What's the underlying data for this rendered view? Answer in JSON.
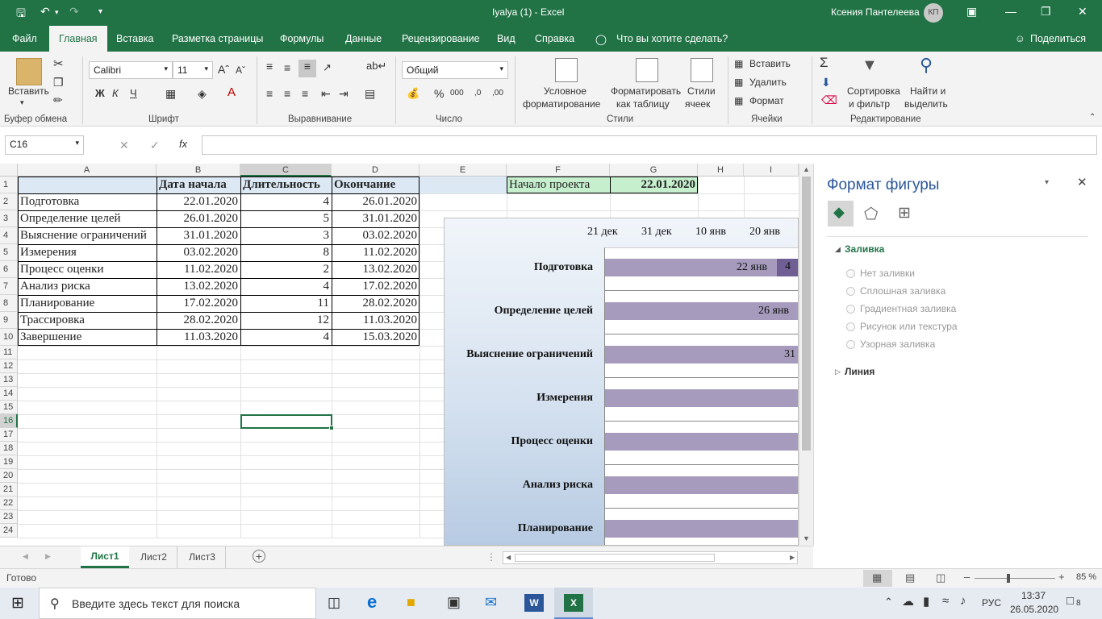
{
  "titlebar": {
    "doc_title": "Iyalya (1)  -  Excel",
    "user": "Ксения Пантелеева",
    "initials": "КП"
  },
  "menu": {
    "file": "Файл",
    "home": "Главная",
    "insert": "Вставка",
    "layout": "Разметка страницы",
    "formulas": "Формулы",
    "data": "Данные",
    "review": "Рецензирование",
    "view": "Вид",
    "help": "Справка",
    "tell": "Что вы хотите сделать?",
    "share": "Поделиться"
  },
  "ribbon": {
    "paste": "Вставить",
    "clipboard": "Буфер обмена",
    "font_name": "Calibri",
    "font_size": "11",
    "bold": "Ж",
    "italic": "К",
    "underline": "Ч",
    "font_group": "Шрифт",
    "align_group": "Выравнивание",
    "number_format": "Общий",
    "number_group": "Число",
    "cond_format_1": "Условное",
    "cond_format_2": "форматирование",
    "fmt_table_1": "Форматировать",
    "fmt_table_2": "как таблицу",
    "cell_styles_1": "Стили",
    "cell_styles_2": "ячеек",
    "styles_group": "Стили",
    "insert_cells": "Вставить",
    "delete_cells": "Удалить",
    "format_cells": "Формат",
    "cells_group": "Ячейки",
    "sort_1": "Сортировка",
    "sort_2": "и фильтр",
    "find_1": "Найти и",
    "find_2": "выделить",
    "editing_group": "Редактирование"
  },
  "formula_bar": {
    "name_box": "C16",
    "formula": ""
  },
  "columns": [
    "A",
    "B",
    "C",
    "D",
    "E",
    "F",
    "G",
    "H",
    "I"
  ],
  "rows": [
    "1",
    "2",
    "3",
    "4",
    "5",
    "6",
    "7",
    "8",
    "9",
    "10",
    "11",
    "12",
    "13",
    "14",
    "15",
    "16",
    "17",
    "18",
    "19",
    "20",
    "21",
    "22",
    "23",
    "24"
  ],
  "table": {
    "headers": [
      "Дата начала",
      "Длительность",
      "Окончание"
    ],
    "rows": [
      [
        "Подготовка",
        "22.01.2020",
        "4",
        "26.01.2020"
      ],
      [
        "Определение целей",
        "26.01.2020",
        "5",
        "31.01.2020"
      ],
      [
        "Выяснение ограничений",
        "31.01.2020",
        "3",
        "03.02.2020"
      ],
      [
        "Измерения",
        "03.02.2020",
        "8",
        "11.02.2020"
      ],
      [
        "Процесс оценки",
        "11.02.2020",
        "2",
        "13.02.2020"
      ],
      [
        "Анализ риска",
        "13.02.2020",
        "4",
        "17.02.2020"
      ],
      [
        "Планирование",
        "17.02.2020",
        "11",
        "28.02.2020"
      ],
      [
        "Трассировка",
        "28.02.2020",
        "12",
        "11.03.2020"
      ],
      [
        "Завершение",
        "11.03.2020",
        "4",
        "15.03.2020"
      ]
    ],
    "project_start_label": "Начало проекта",
    "project_start_value": "22.01.2020"
  },
  "chart_data": {
    "type": "bar",
    "x_tick_labels": [
      "21 дек",
      "31 дек",
      "10 янв",
      "20 янв"
    ],
    "categories": [
      "Подготовка",
      "Определение целей",
      "Выяснение ограничений",
      "Измерения",
      "Процесс оценки",
      "Анализ риска",
      "Планирование"
    ],
    "bar_labels": [
      "22 янв",
      "26 янв",
      "31",
      "",
      "",
      "",
      ""
    ],
    "duration_labels": [
      "4"
    ],
    "colors": {
      "bar": "#a69bbd",
      "duration": "#6f5f94"
    }
  },
  "format_panel": {
    "title": "Формат фигуры",
    "fill_section": "Заливка",
    "options": [
      "Нет заливки",
      "Сплошная заливка",
      "Градиентная заливка",
      "Рисунок или текстура",
      "Узорная заливка"
    ],
    "line_section": "Линия"
  },
  "sheets": [
    "Лист1",
    "Лист2",
    "Лист3"
  ],
  "status": {
    "ready": "Готово",
    "zoom": "85 %"
  },
  "taskbar": {
    "search_placeholder": "Введите здесь текст для поиска",
    "lang": "РУС",
    "time": "13:37",
    "date": "26.05.2020",
    "notifications": "8"
  }
}
